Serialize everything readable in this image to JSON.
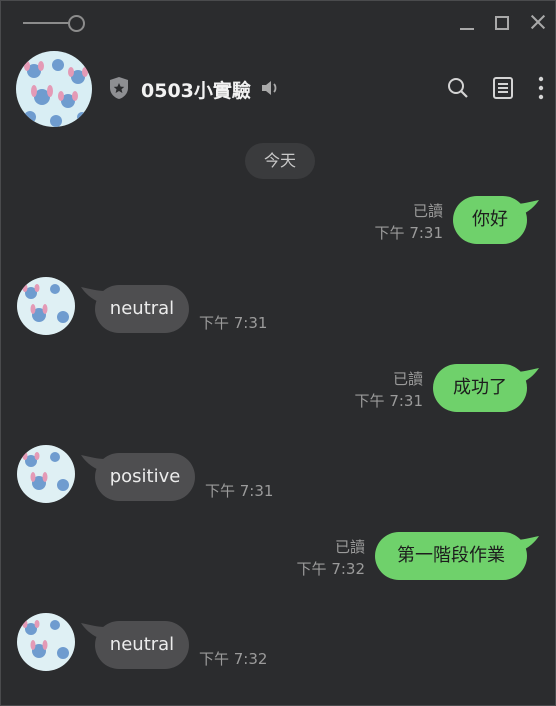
{
  "window": {
    "controls": [
      "pin-toggle",
      "minimize",
      "maximize",
      "close"
    ]
  },
  "header": {
    "title": "0503小實驗",
    "icons": [
      "shield-star-icon",
      "speaker-icon",
      "search-icon",
      "notes-icon",
      "more-vertical-icon"
    ]
  },
  "date_separator": "今天",
  "messages": [
    {
      "direction": "out",
      "text": "你好",
      "read_label": "已讀",
      "time": "下午 7:31"
    },
    {
      "direction": "in",
      "text": "neutral",
      "time": "下午 7:31"
    },
    {
      "direction": "out",
      "text": "成功了",
      "read_label": "已讀",
      "time": "下午 7:31"
    },
    {
      "direction": "in",
      "text": "positive",
      "time": "下午 7:31"
    },
    {
      "direction": "out",
      "text": "第一階段作業",
      "read_label": "已讀",
      "time": "下午 7:32"
    },
    {
      "direction": "in",
      "text": "neutral",
      "time": "下午 7:32"
    }
  ],
  "colors": {
    "background": "#2b2c2e",
    "outgoing_bubble": "#6fd16b",
    "incoming_bubble": "#4e4e50",
    "meta_text": "#9b9b9b"
  }
}
